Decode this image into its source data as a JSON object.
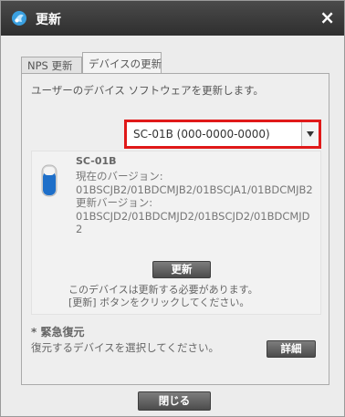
{
  "window": {
    "title": "更新",
    "close_glyph": "×"
  },
  "tabs": [
    {
      "label": "NPS 更新"
    },
    {
      "label": "デバイスの更新"
    }
  ],
  "panel": {
    "intro": "ユーザーのデバイス ソフトウェアを更新します。",
    "device_select": {
      "value": "SC-01B (000-0000-0000)"
    },
    "device": {
      "name": "SC-01B",
      "current_label": "現在のバージョン:",
      "current_version": "01BSCJB2/01BDCMJB2/01BSCJA1/01BDCMJB2",
      "update_label": "更新バージョン:",
      "update_version": "01BSCJD2/01BDCMJD2/01BSCJD2/01BDCMJD2",
      "update_button": "更新",
      "note_line1": "このデバイスは更新する必要があります。",
      "note_line2": "[更新] ボタンをクリックしてください。"
    },
    "emergency": {
      "title": "* 緊急復元",
      "desc": "復元するデバイスを選択してください。",
      "detail_button": "詳細"
    }
  },
  "footer": {
    "close_button": "閉じる"
  },
  "colors": {
    "titlebar": "#3a3a3a",
    "highlight": "#e01919",
    "device_icon_blue": "#1e6fc9"
  }
}
